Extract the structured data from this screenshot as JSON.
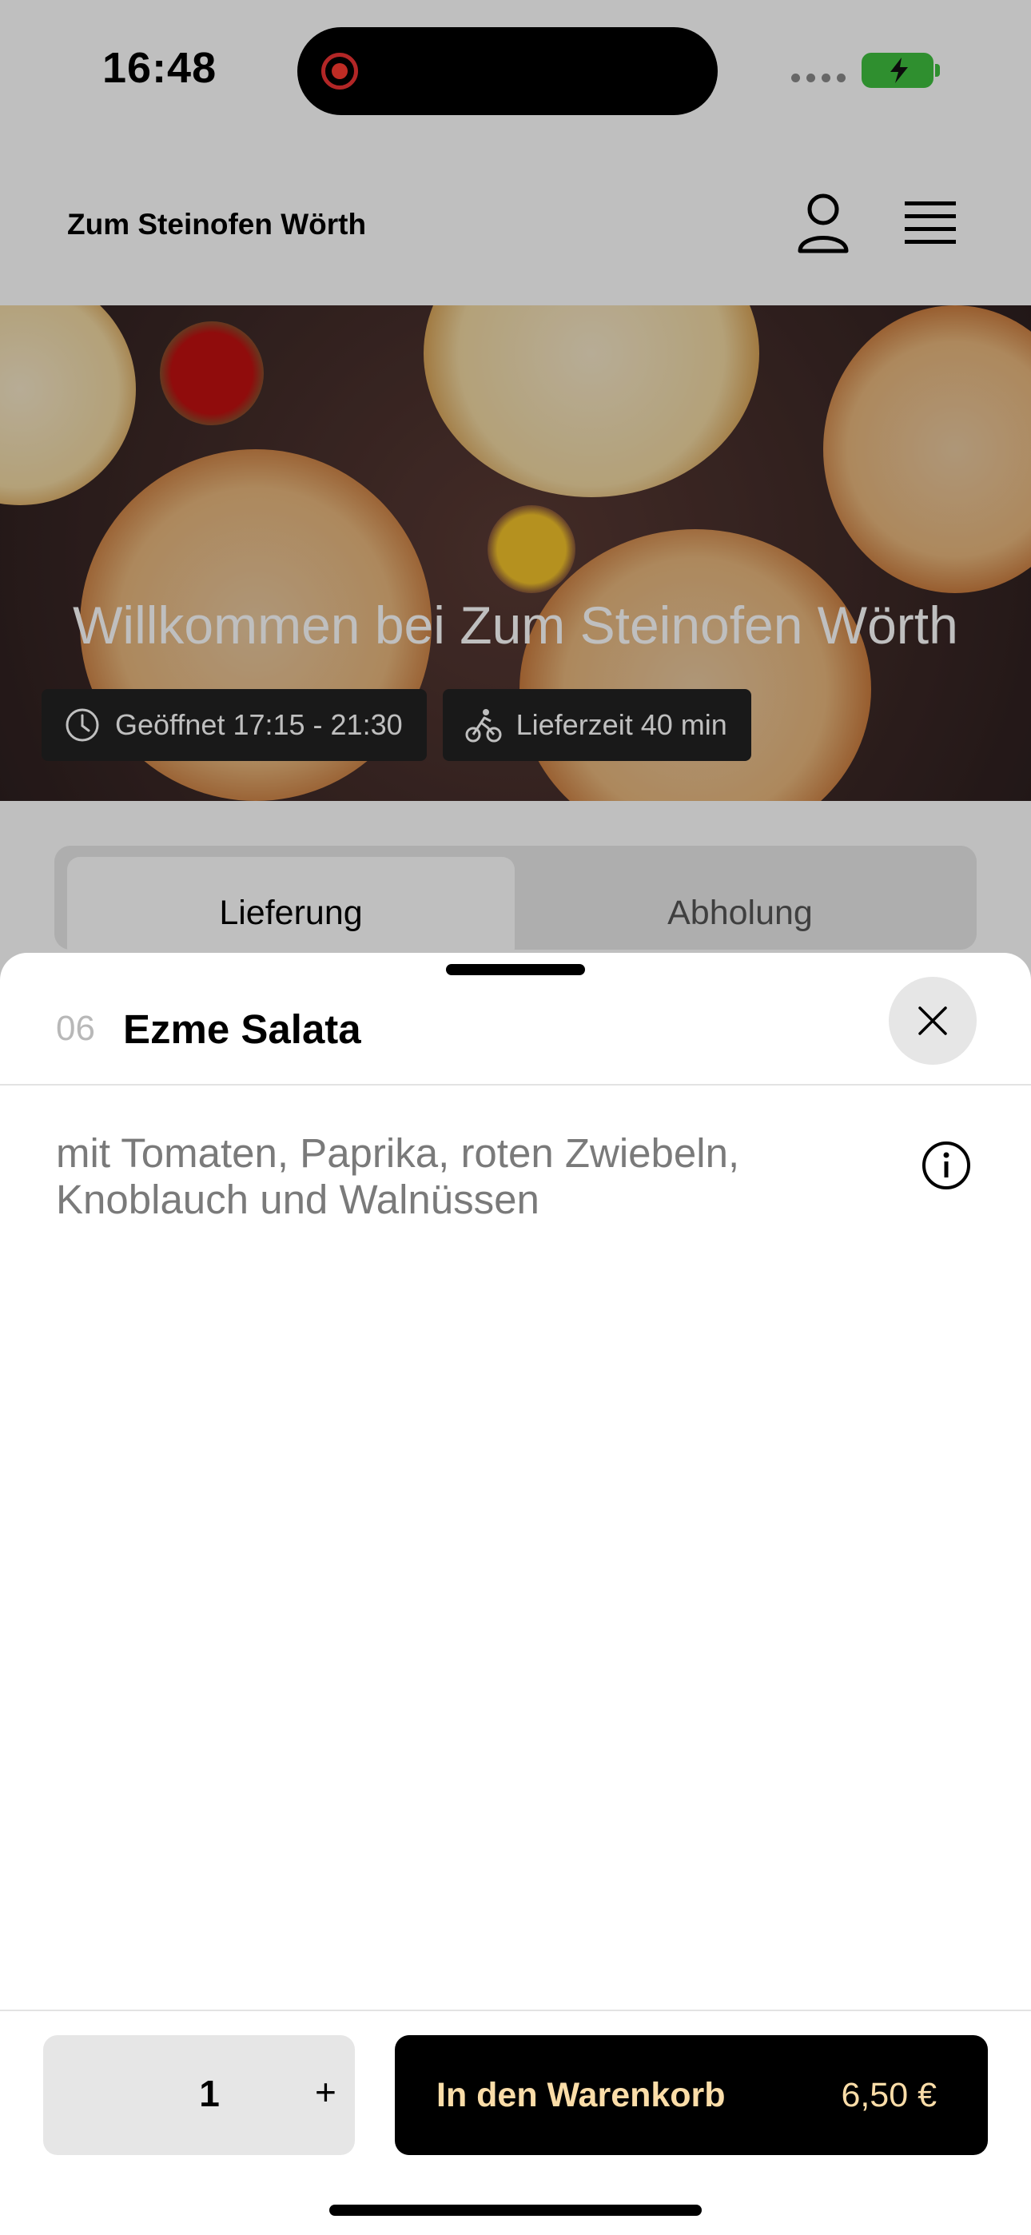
{
  "status_bar": {
    "time": "16:48",
    "battery_icon": "battery-charging-icon",
    "signal_icon": "cellular-signal-icon",
    "recording_icon": "screen-recording-icon"
  },
  "header": {
    "brand": "Zum Steinofen Wörth",
    "user_icon": "user-icon",
    "menu_icon": "hamburger-menu-icon"
  },
  "hero": {
    "title": "Willkommen bei Zum Steinofen Wörth",
    "opening_hours": "Geöffnet 17:15 - 21:30",
    "delivery_time": "Lieferzeit 40 min",
    "clock_icon": "clock-icon",
    "bike_icon": "bicycle-courier-icon"
  },
  "tabs": {
    "delivery": "Lieferung",
    "pickup": "Abholung",
    "selected": "Lieferung"
  },
  "sheet": {
    "item_number": "06",
    "item_name": "Ezme Salata",
    "description": "mit Tomaten, Paprika, roten Zwiebeln, Knoblauch und Walnüssen",
    "close_icon": "close-icon",
    "info_icon": "info-icon"
  },
  "footer": {
    "quantity": "1",
    "plus": "+",
    "cart_label": "In den Warenkorb",
    "price": "6,50 €"
  },
  "colors": {
    "accent_text": "#fbdda8",
    "button_bg": "#000000",
    "battery": "#3fbf3f",
    "recording": "#ff3b30"
  }
}
